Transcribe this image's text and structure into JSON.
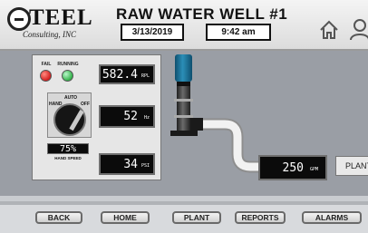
{
  "header": {
    "logo_main": "TEEL",
    "logo_sub": "Consulting, INC",
    "title": "RAW WATER WELL #1",
    "date": "3/13/2019",
    "time": "9:42 am"
  },
  "status": {
    "fail_label": "FAIL",
    "running_label": "RUNNING"
  },
  "readouts": {
    "pressure_top": {
      "value": "582.4",
      "unit": "RPL"
    },
    "frequency": {
      "value": "52",
      "unit": "Hz"
    },
    "pressure": {
      "value": "34",
      "unit": "PSI"
    },
    "flow": {
      "value": "250",
      "unit": "GPM"
    }
  },
  "selector": {
    "auto_label": "AUTO",
    "hand_label": "HAND",
    "off_label": "OFF"
  },
  "speed": {
    "value": "75%",
    "label": "HAND SPEED"
  },
  "side_button": {
    "label": "PLANT"
  },
  "nav": {
    "back": "BACK",
    "home": "HOME",
    "plant": "PLANT",
    "reports": "REPORTS",
    "alarms": "ALARMS"
  },
  "colors": {
    "fail": "#d21f1f",
    "running": "#33b24a",
    "motor": "#2b8fb8",
    "background": "#9a9ea5"
  }
}
